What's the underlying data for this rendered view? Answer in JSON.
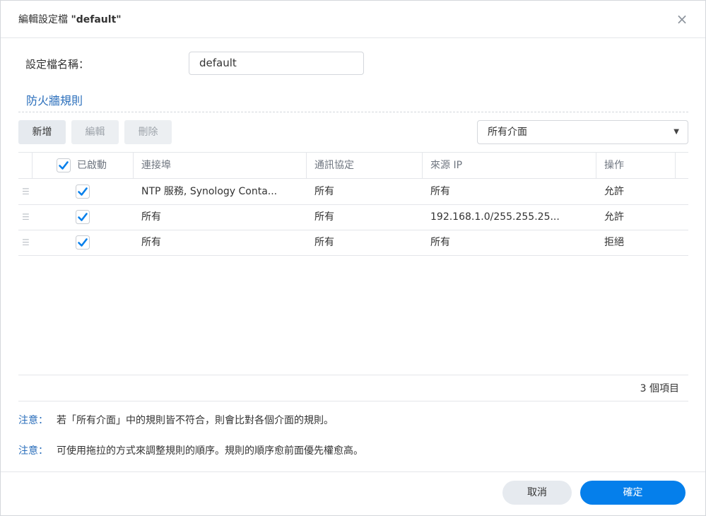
{
  "dialog": {
    "title_prefix": "編輯設定檔",
    "title_name": "\"default\"",
    "close_icon": "×"
  },
  "profile": {
    "name_label": "設定檔名稱：",
    "name_value": "default"
  },
  "section": {
    "title": "防火牆規則"
  },
  "toolbar": {
    "add_label": "新增",
    "edit_label": "編輯",
    "delete_label": "刪除",
    "interface_select": "所有介面"
  },
  "table": {
    "headers": {
      "enabled": "已啟動",
      "ports": "連接埠",
      "protocol": "通訊協定",
      "source_ip": "來源 IP",
      "action": "操作"
    },
    "rows": [
      {
        "ports": "NTP 服務, Synology Conta...",
        "protocol": "所有",
        "source_ip": "所有",
        "action": "允許"
      },
      {
        "ports": "所有",
        "protocol": "所有",
        "source_ip": "192.168.1.0/255.255.25...",
        "action": "允許"
      },
      {
        "ports": "所有",
        "protocol": "所有",
        "source_ip": "所有",
        "action": "拒絕"
      }
    ],
    "item_count": "3 個項目"
  },
  "notes": [
    {
      "key": "注意：",
      "text": "若「所有介面」中的規則皆不符合，則會比對各個介面的規則。"
    },
    {
      "key": "注意：",
      "text": "可使用拖拉的方式來調整規則的順序。規則的順序愈前面優先權愈高。"
    }
  ],
  "buttons": {
    "cancel": "取消",
    "ok": "確定"
  },
  "colors": {
    "accent": "#057feb",
    "link": "#2a6ebb"
  }
}
